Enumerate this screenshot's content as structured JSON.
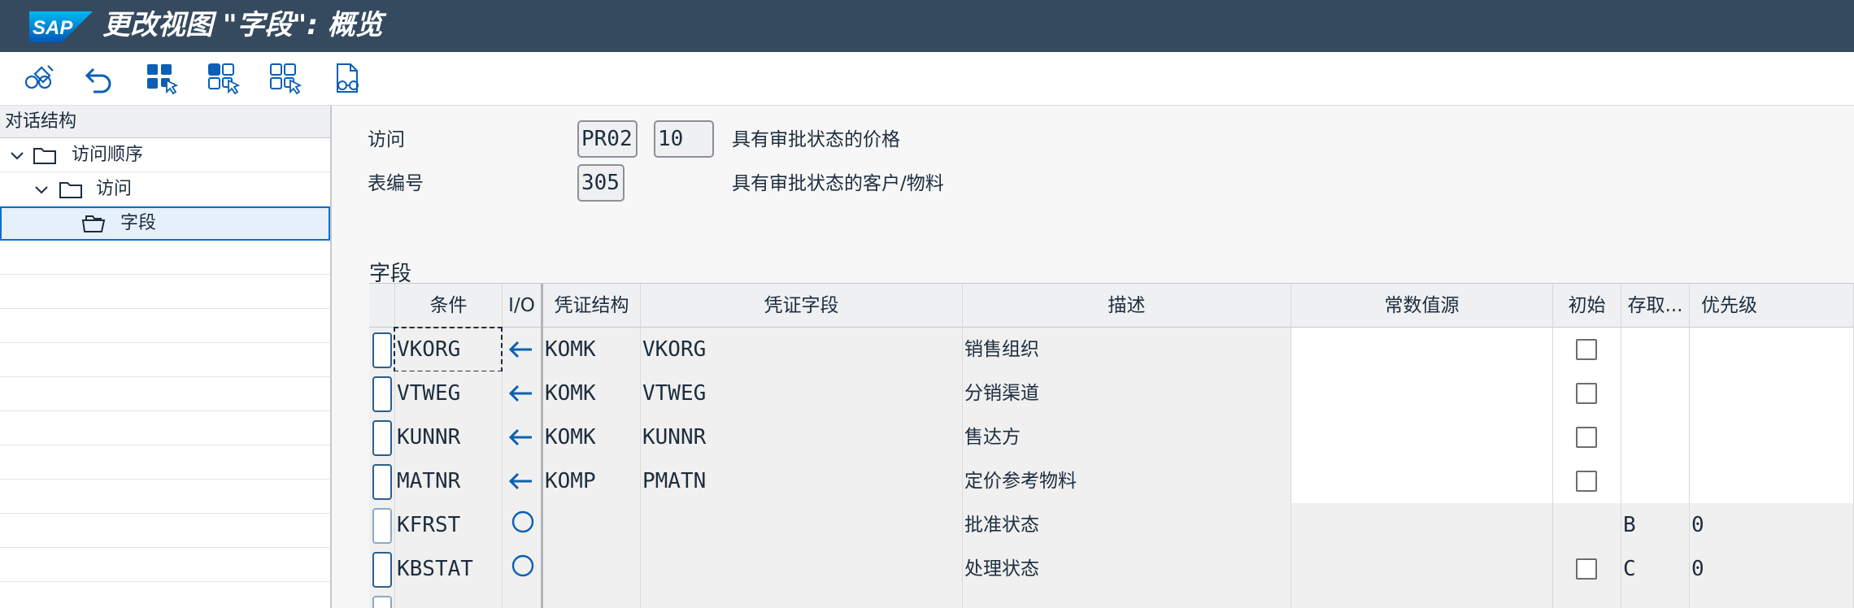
{
  "window": {
    "title": "更改视图 \"字段\": 概览",
    "logo_text": "SAP"
  },
  "toolbar": {
    "buttons": [
      {
        "name": "display-change-button",
        "icon": "glasses-pencil-icon"
      },
      {
        "name": "undo-button",
        "icon": "undo-icon"
      },
      {
        "name": "select-all-button",
        "icon": "select-all-icon"
      },
      {
        "name": "select-block-button",
        "icon": "select-block-icon"
      },
      {
        "name": "deselect-all-button",
        "icon": "deselect-all-icon"
      },
      {
        "name": "print-button",
        "icon": "document-glasses-icon"
      }
    ]
  },
  "nav": {
    "header": "对话结构",
    "items": [
      {
        "label": "访问顺序",
        "level": 0,
        "expanded": true,
        "selected": false,
        "icon": "folder-icon"
      },
      {
        "label": "访问",
        "level": 1,
        "expanded": true,
        "selected": false,
        "icon": "folder-icon"
      },
      {
        "label": "字段",
        "level": 2,
        "expanded": false,
        "selected": true,
        "icon": "folder-open-icon"
      }
    ]
  },
  "header_fields": {
    "access_label": "访问",
    "access_sequence": "PR02",
    "access_number": "10",
    "access_desc": "具有审批状态的价格",
    "table_label": "表编号",
    "table_number": "305",
    "table_desc": "具有审批状态的客户/物料"
  },
  "section": {
    "title": "字段"
  },
  "grid": {
    "columns": [
      "条件",
      "I/O",
      "凭证结构",
      "凭证字段",
      "描述",
      "常数值源",
      "初始",
      "存取...",
      "优先级"
    ],
    "rows": [
      {
        "condition": "VKORG",
        "io": "arrow-left",
        "doc_structure": "KOMK",
        "doc_field": "VKORG",
        "description": "销售组织",
        "initial": true,
        "access": "",
        "priority": "",
        "focused": true
      },
      {
        "condition": "VTWEG",
        "io": "arrow-left",
        "doc_structure": "KOMK",
        "doc_field": "VTWEG",
        "description": "分销渠道",
        "initial": true,
        "access": "",
        "priority": "",
        "focused": false
      },
      {
        "condition": "KUNNR",
        "io": "arrow-left",
        "doc_structure": "KOMK",
        "doc_field": "KUNNR",
        "description": "售达方",
        "initial": true,
        "access": "",
        "priority": "",
        "focused": false
      },
      {
        "condition": "MATNR",
        "io": "arrow-left",
        "doc_structure": "KOMP",
        "doc_field": "PMATN",
        "description": "定价参考物料",
        "initial": true,
        "access": "",
        "priority": "",
        "focused": false
      },
      {
        "condition": "KFRST",
        "io": "circle",
        "doc_structure": "",
        "doc_field": "",
        "description": "批准状态",
        "initial": false,
        "access": "B",
        "priority": "0",
        "focused": false
      },
      {
        "condition": "KBSTAT",
        "io": "circle",
        "doc_structure": "",
        "doc_field": "",
        "description": "处理状态",
        "initial": true,
        "access": "C",
        "priority": "0",
        "focused": false
      }
    ]
  },
  "colors": {
    "shell": "#354a5f",
    "accent": "#0a6ed1",
    "icon_blue": "#0b5fb5"
  }
}
